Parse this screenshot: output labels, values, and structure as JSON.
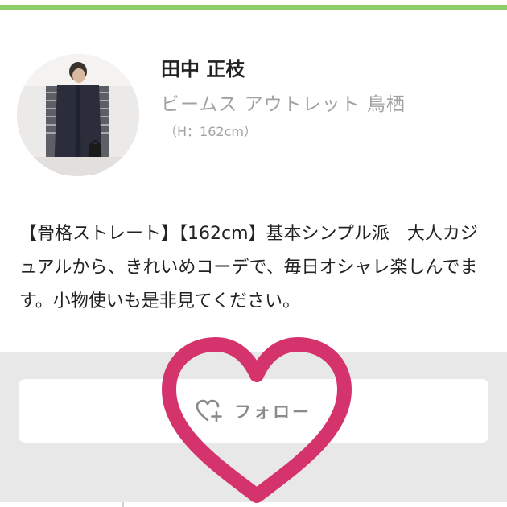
{
  "colors": {
    "accent_bar": "#8ccf6a",
    "heart_overlay": "#d5336c",
    "follow_text": "#8a8a8a",
    "secondary_text": "#a2a2a2"
  },
  "profile": {
    "name": "田中 正枝",
    "shop": "ビームス アウトレット 鳥栖",
    "height": "（H：162cm）",
    "bio": "【骨格ストレート】【162cm】基本シンプル派　大人カジュアルから、きれいめコーデで、毎日オシャレ楽しんでます。小物使いも是非見てください。"
  },
  "follow": {
    "label": "フォロー",
    "icon": "heart-plus-icon"
  },
  "overlay": {
    "icon": "heart-outline-icon"
  }
}
